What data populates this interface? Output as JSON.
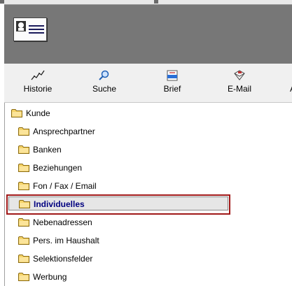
{
  "toolbar": {
    "buttons": [
      {
        "label": "Historie",
        "icon": "history-chart-icon"
      },
      {
        "label": "Suche",
        "icon": "search-magnifier-icon"
      },
      {
        "label": "Brief",
        "icon": "letter-icon"
      },
      {
        "label": "E-Mail",
        "icon": "email-icon"
      },
      {
        "label": "A",
        "icon": "next-icon"
      }
    ]
  },
  "tree": {
    "root": {
      "label": "Kunde"
    },
    "items": [
      {
        "label": "Ansprechpartner"
      },
      {
        "label": "Banken"
      },
      {
        "label": "Beziehungen"
      },
      {
        "label": "Fon / Fax / Email"
      },
      {
        "label": "Individuelles"
      },
      {
        "label": "Nebenadressen"
      },
      {
        "label": "Pers. im Haushalt"
      },
      {
        "label": "Selektionsfelder"
      },
      {
        "label": "Werbung"
      }
    ],
    "selected": "Individuelles"
  },
  "colors": {
    "header_bg": "#777777",
    "selection_border": "#a01818",
    "selected_text": "#000080",
    "folder": "#f2c94c"
  }
}
